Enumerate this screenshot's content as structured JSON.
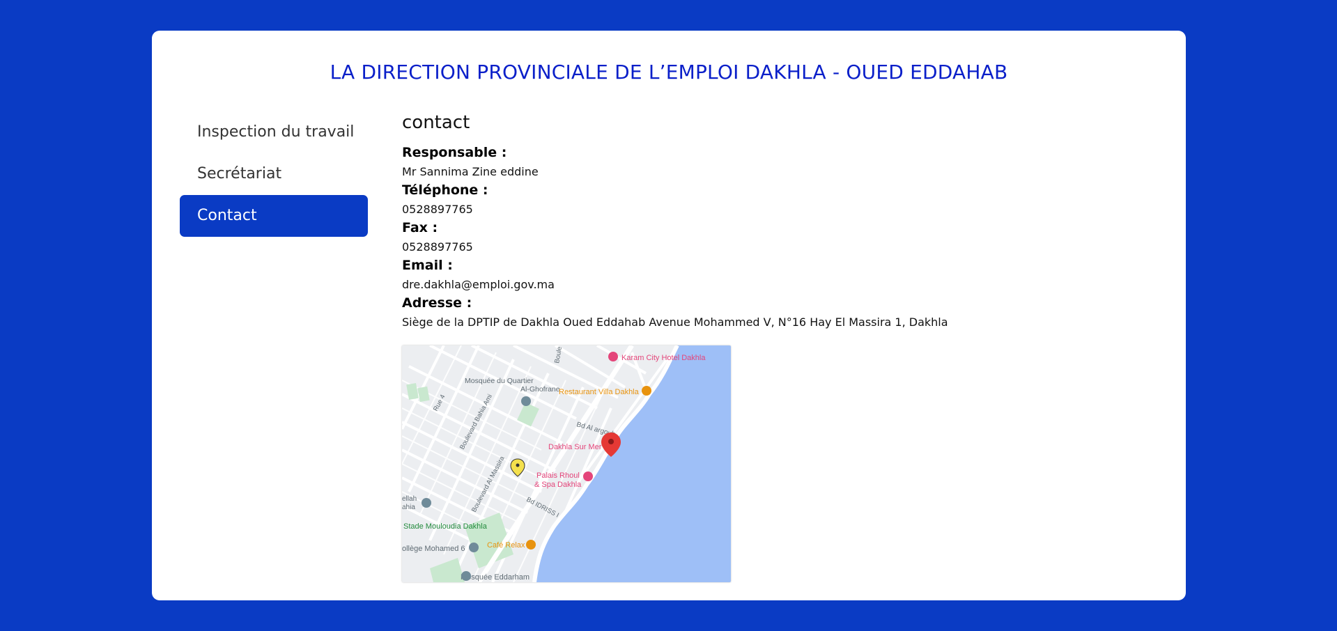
{
  "header": {
    "title": "LA DIRECTION PROVINCIALE DE L’EMPLOI DAKHLA - OUED EDDAHAB"
  },
  "sidebar": {
    "items": [
      {
        "label": "Inspection du travail",
        "active": false
      },
      {
        "label": "Secrétariat",
        "active": false
      },
      {
        "label": "Contact",
        "active": true
      }
    ]
  },
  "contact": {
    "title": "contact",
    "fields": [
      {
        "label": "Responsable :",
        "value": "Mr Sannima Zine eddine"
      },
      {
        "label": "Téléphone :",
        "value": "0528897765"
      },
      {
        "label": "Fax :",
        "value": "0528897765"
      },
      {
        "label": "Email :",
        "value": "dre.dakhla@emploi.gov.ma"
      },
      {
        "label": "Adresse :",
        "value": "Siège de la DPTIP de Dakhla Oued Eddahab Avenue Mohammed V, N°16 Hay El Massira 1, Dakhla"
      }
    ]
  },
  "map": {
    "labels": [
      {
        "text": "Karam City Hotel Dakhla"
      },
      {
        "text": "Mosquée du Quartier"
      },
      {
        "text": "Al-Ghofrane"
      },
      {
        "text": "Restaurant Villa Dakhla"
      },
      {
        "text": "Bd Al argoub"
      },
      {
        "text": "Dakhla Sur Mer"
      },
      {
        "text": "Palais Rhoul"
      },
      {
        "text": "& Spa Dakhla"
      },
      {
        "text": "Boulevard Al Massira"
      },
      {
        "text": "Boulevard Bahia Ami"
      },
      {
        "text": "Bd IDRISS I"
      },
      {
        "text": "Stade Mouloudia Dakhla"
      },
      {
        "text": "Café Relax"
      },
      {
        "text": "ollège Mohamed 6"
      },
      {
        "text": "Mosquée Eddarham"
      },
      {
        "text": "Rue 4"
      },
      {
        "text": "Boule"
      },
      {
        "text": "ellah"
      },
      {
        "text": "ahia"
      }
    ],
    "colors": {
      "sea": "#9ebff7",
      "land": "#eceef1",
      "road": "#ffffff",
      "park": "#c9e8cf",
      "hotel": "#e4457a",
      "restaurant": "#e8930f",
      "mosque": "#6f8b99",
      "park_label": "#238b3d",
      "marker_red": "#e53935",
      "marker_yellow": "#f4e04d"
    }
  },
  "colors": {
    "background": "#0a3bc4",
    "title": "#0a1fc9",
    "active_nav": "#0a3bc4"
  }
}
